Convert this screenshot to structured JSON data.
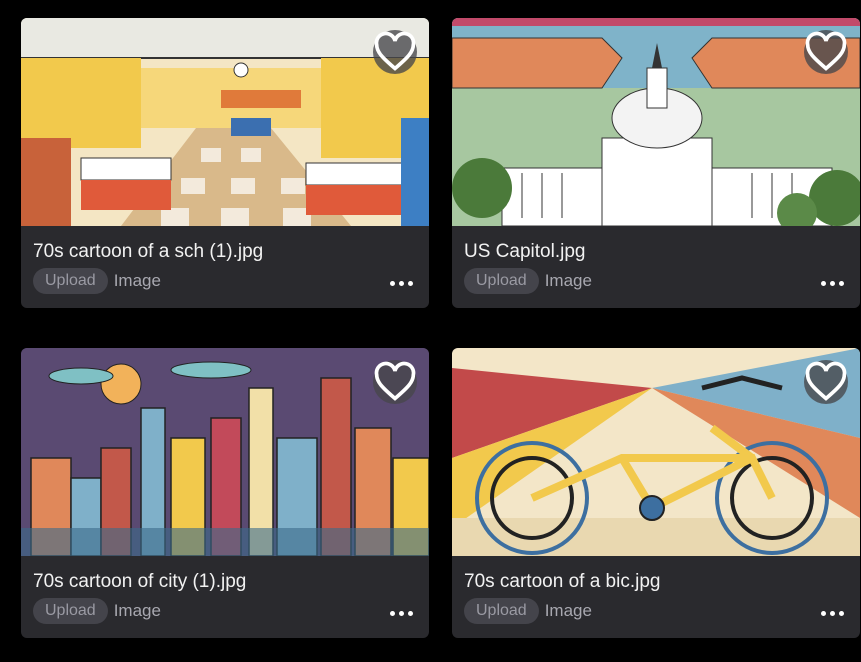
{
  "cards": [
    {
      "title": "70s cartoon of a sch (1).jpg",
      "badge": "Upload",
      "type": "Image"
    },
    {
      "title": "US Capitol.jpg",
      "badge": "Upload",
      "type": "Image"
    },
    {
      "title": "70s cartoon of city (1).jpg",
      "badge": "Upload",
      "type": "Image"
    },
    {
      "title": "70s cartoon of a bic.jpg",
      "badge": "Upload",
      "type": "Image"
    }
  ],
  "icons": {
    "favorite": "heart-icon",
    "more": "more-horizontal-icon"
  }
}
